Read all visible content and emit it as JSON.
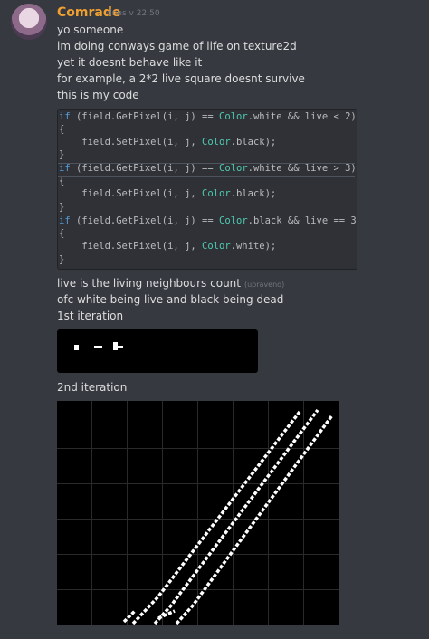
{
  "message": {
    "author": "Comrade",
    "timestamp": "dnes v 22:50",
    "edited": "(upraveno)",
    "lines": [
      "yo someone",
      "im doing conways game of life on texture2d",
      "yet it doesnt behave like it",
      "for example, a 2*2 live square doesnt survive",
      "this is my code"
    ],
    "after_code": [
      "live is the living neighbours count",
      "ofc white being live and black being dead",
      "1st iteration"
    ],
    "second_label": "2nd iteration"
  },
  "code": {
    "lines": [
      "if (field.GetPixel(i, j) == Color.white && live < 2)",
      "{",
      "    field.SetPixel(i, j, Color.black);",
      "}",
      "if (field.GetPixel(i, j) == Color.white && live > 3)",
      "{",
      "    field.SetPixel(i, j, Color.black);",
      "}",
      "if (field.GetPixel(i, j) == Color.black && live == 3)",
      "{",
      "    field.SetPixel(i, j, Color.white);",
      "}"
    ]
  },
  "colors": {
    "background": "#36393f",
    "author": "#f0a030",
    "codeblock": "#2f3136",
    "keyword": "#569cd6",
    "type": "#4ec9b0"
  }
}
